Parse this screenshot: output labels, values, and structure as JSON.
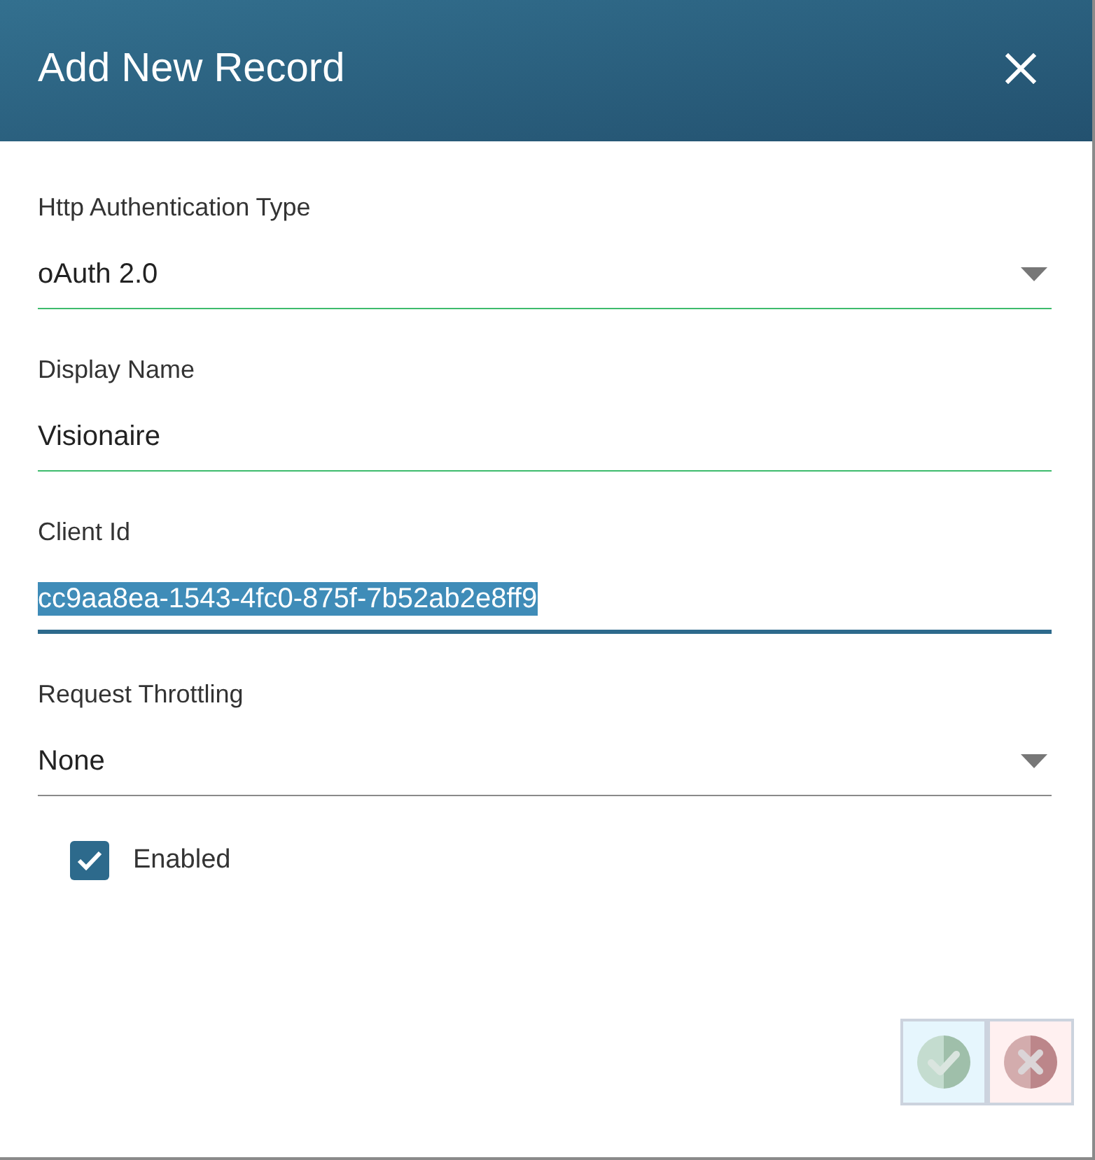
{
  "dialog": {
    "title": "Add New Record"
  },
  "fields": [
    {
      "kind": "select",
      "label": "Http Authentication Type",
      "value": "oAuth 2.0",
      "valid": true,
      "focused": false,
      "text_selected": false
    },
    {
      "kind": "text",
      "label": "Display Name",
      "value": "Visionaire",
      "valid": true,
      "focused": false,
      "text_selected": false
    },
    {
      "kind": "text",
      "label": "Client Id",
      "value": "cc9aa8ea-1543-4fc0-875f-7b52ab2e8ff9",
      "valid": false,
      "focused": true,
      "text_selected": true
    },
    {
      "kind": "select",
      "label": "Request Throttling",
      "value": "None",
      "valid": false,
      "focused": false,
      "text_selected": false
    }
  ],
  "checkbox": {
    "label": "Enabled",
    "checked": true
  },
  "actions": [
    {
      "kind": "confirm",
      "disabled": true
    },
    {
      "kind": "cancel",
      "disabled": true
    }
  ]
}
